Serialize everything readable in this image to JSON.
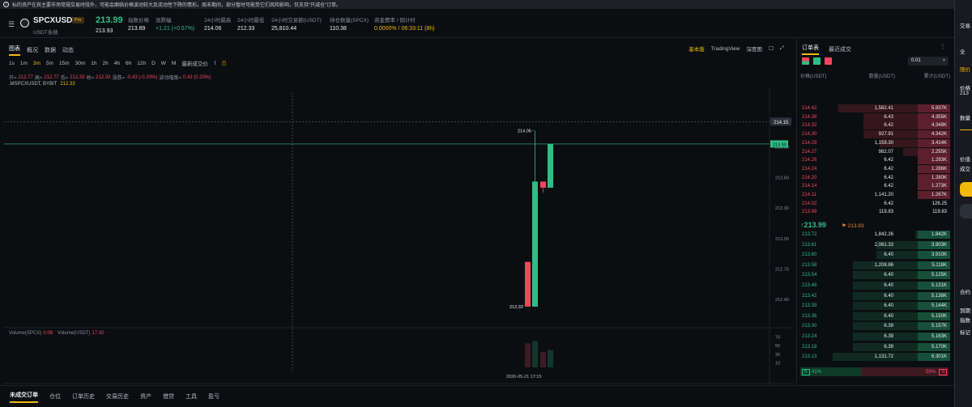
{
  "notice": {
    "text": "标的资产在其主要市场常规交易时段外，可能会面临价格波动较大及流动性下降的情形。周末期间，部分暂时可能受它们风险影响，仅支持“只减仓”订单。"
  },
  "header": {
    "symbol": "SPCXUSDT",
    "badge": "Pre",
    "contract_type": "USDT永续",
    "last_price": "213.99",
    "mark_price": "213.93",
    "stats": [
      {
        "label": "指数价格",
        "value": "213.89",
        "color": "#eaecef"
      },
      {
        "label": "涨跌幅",
        "value": "+1.21 (+0.57%)",
        "color": "#2ebd85"
      },
      {
        "label": "24小时最高",
        "value": "214.06",
        "color": "#eaecef"
      },
      {
        "label": "24小时最低",
        "value": "212.33",
        "color": "#eaecef"
      },
      {
        "label": "24小时交易额(USDT)",
        "value": "25,810.44",
        "color": "#eaecef"
      },
      {
        "label": "持仓数量(SPCX)",
        "value": "110.38",
        "color": "#eaecef"
      },
      {
        "label": "资金费率 / 倒计时",
        "value": "0.0000% / 06:33:11 (8h)",
        "color": "#f0b90b"
      }
    ]
  },
  "chart": {
    "tabs": [
      "图表",
      "概况",
      "数据",
      "动态"
    ],
    "view_tabs": [
      "基本版",
      "TradingView",
      "深度图"
    ],
    "intervals": [
      "1s",
      "1m",
      "3m",
      "5m",
      "15m",
      "30m",
      "1h",
      "2h",
      "4h",
      "6h",
      "12h",
      "D",
      "W",
      "M",
      "最新成交价"
    ],
    "active_interval": "3m",
    "ohlc": {
      "open_label": "开=",
      "open": "212.77",
      "high_label": "高=",
      "high": "212.77",
      "low_label": "低=",
      "low": "212.33",
      "close_label": "收=",
      "close": "212.33",
      "change_label": "涨跌=",
      "change": "-0.43 (-0.20%)",
      "amp_label": "波动幅度=",
      "amp": "0.43 (0.20%)"
    },
    "indicator_name": ".MSPCXUSDT, BYBIT",
    "indicator_value": "212.33",
    "volume_label": "Volume(SPCX)",
    "volume_value": "0.08",
    "volume_usdt_label": "Volume(USDT)",
    "volume_usdt_value": "17.00",
    "price_ticks": [
      "213.90",
      "213.60",
      "213.30",
      "213.00",
      "212.70",
      "212.40"
    ],
    "volume_ticks": [
      "70",
      "50",
      "30",
      "10"
    ],
    "current_price_tag": "213.90",
    "dotted_price_tag": "214.15",
    "high_annotation": "214.06",
    "low_annotation": "212.33",
    "time_label": "2026-05-21 17:15"
  },
  "chart_data": {
    "type": "candlestick",
    "candles": [
      {
        "o": 212.77,
        "h": 212.77,
        "l": 212.33,
        "c": 212.33
      },
      {
        "o": 212.33,
        "h": 214.06,
        "l": 212.33,
        "c": 213.56
      },
      {
        "o": 213.56,
        "h": 213.56,
        "l": 213.45,
        "c": 213.5
      },
      {
        "o": 213.5,
        "h": 213.93,
        "l": 213.5,
        "c": 213.93
      }
    ],
    "ylim": [
      212.25,
      214.2
    ],
    "volumes": [
      55,
      60,
      35,
      40
    ],
    "volume_ylim": [
      0,
      80
    ]
  },
  "orderbook": {
    "tabs": [
      "订单表",
      "最近成交"
    ],
    "precision": "0.01",
    "headers": [
      "价格(USDT)",
      "数量(USDT)",
      "累计(USDT)"
    ],
    "asks": [
      {
        "price": "214.42",
        "qty": "1,582.41",
        "cum": "5.937K",
        "depth": 0.95
      },
      {
        "price": "214.38",
        "qty": "6.43",
        "cum": "4.355K",
        "depth": 0.74
      },
      {
        "price": "214.32",
        "qty": "6.42",
        "cum": "4.348K",
        "depth": 0.74
      },
      {
        "price": "214.30",
        "qty": "927.91",
        "cum": "4.342K",
        "depth": 0.74
      },
      {
        "price": "214.29",
        "qty": "1,159.30",
        "cum": "3.414K",
        "depth": 0.6
      },
      {
        "price": "214.27",
        "qty": "982.07",
        "cum": "2.255K",
        "depth": 0.4
      },
      {
        "price": "214.26",
        "qty": "6.42",
        "cum": "1.293K",
        "depth": 0.23
      },
      {
        "price": "214.24",
        "qty": "6.42",
        "cum": "1.286K",
        "depth": 0.23
      },
      {
        "price": "214.20",
        "qty": "6.42",
        "cum": "1.280K",
        "depth": 0.23
      },
      {
        "price": "214.14",
        "qty": "6.42",
        "cum": "1.273K",
        "depth": 0.23
      },
      {
        "price": "214.11",
        "qty": "1,141.20",
        "cum": "1.267K",
        "depth": 0.23
      },
      {
        "price": "214.02",
        "qty": "6.42",
        "cum": "126.25",
        "depth": 0.0
      },
      {
        "price": "213.99",
        "qty": "119.83",
        "cum": "119.83",
        "depth": 0.0
      }
    ],
    "mid_price": "↑213.99",
    "mid_mark": "213.93",
    "bids": [
      {
        "price": "213.72",
        "qty": "1,842.26",
        "cum": "1.842K",
        "depth": 0.3
      },
      {
        "price": "213.61",
        "qty": "2,061.33",
        "cum": "3.903K",
        "depth": 0.63
      },
      {
        "price": "213.60",
        "qty": "6.40",
        "cum": "3.910K",
        "depth": 0.63
      },
      {
        "price": "213.58",
        "qty": "1,208.86",
        "cum": "5.118K",
        "depth": 0.83
      },
      {
        "price": "213.54",
        "qty": "6.40",
        "cum": "5.125K",
        "depth": 0.83
      },
      {
        "price": "213.48",
        "qty": "6.40",
        "cum": "5.131K",
        "depth": 0.83
      },
      {
        "price": "213.42",
        "qty": "6.40",
        "cum": "5.138K",
        "depth": 0.83
      },
      {
        "price": "213.39",
        "qty": "6.40",
        "cum": "5.144K",
        "depth": 0.83
      },
      {
        "price": "213.36",
        "qty": "6.40",
        "cum": "5.150K",
        "depth": 0.83
      },
      {
        "price": "213.30",
        "qty": "6.39",
        "cum": "5.157K",
        "depth": 0.83
      },
      {
        "price": "213.24",
        "qty": "6.39",
        "cum": "5.163K",
        "depth": 0.83
      },
      {
        "price": "213.18",
        "qty": "6.39",
        "cum": "5.170K",
        "depth": 0.83
      },
      {
        "price": "213.13",
        "qty": "1,131.72",
        "cum": "6.301K",
        "depth": 1.0
      }
    ],
    "buy_label": "B",
    "buy_pct": "41%",
    "sell_label": "S",
    "sell_pct": "59%",
    "buy_ratio": 0.41
  },
  "right_strip": {
    "items": [
      "交易",
      "全",
      "限价",
      "价格",
      "213",
      "数量",
      "价值",
      "成交",
      "合约",
      "到期",
      "指数",
      "标记"
    ]
  },
  "bottom_tabs": [
    "未成交订单",
    "仓位",
    "订单历史",
    "交易历史",
    "资产",
    "借贷",
    "工具",
    "盈亏"
  ],
  "colors": {
    "up": "#2ebd85",
    "down": "#f6465d",
    "accent": "#f0b90b"
  }
}
